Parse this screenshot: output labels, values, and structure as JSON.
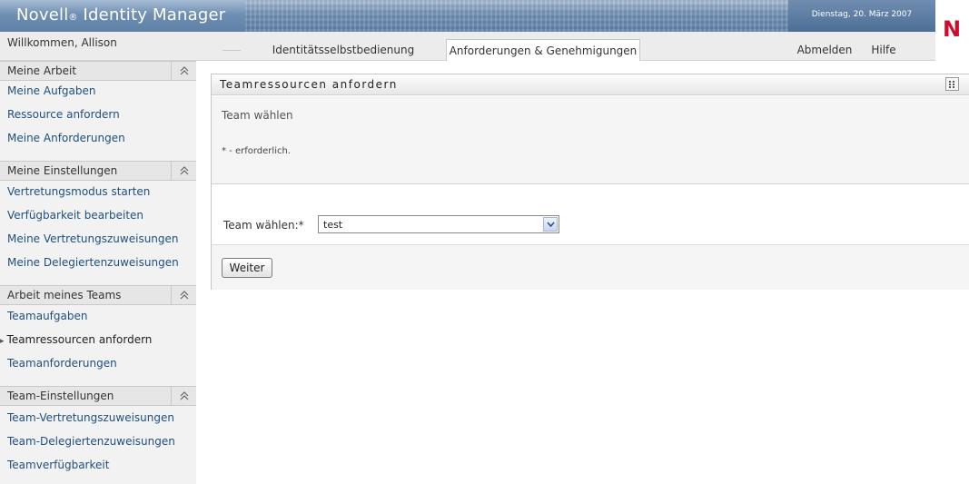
{
  "header": {
    "app_name": "Novell",
    "registered_mark": "®",
    "app_product": "Identity Manager",
    "date": "Dienstag, 20. März 2007",
    "brand_letter": "N"
  },
  "subbar": {
    "welcome": "Willkommen, Allison",
    "tabs": [
      {
        "label": "Identitätsselbstbedienung",
        "active": false
      },
      {
        "label": "Anforderungen & Genehmigungen",
        "active": true
      }
    ],
    "logout": "Abmelden",
    "help": "Hilfe"
  },
  "sidebar": {
    "sections": [
      {
        "title": "Meine Arbeit",
        "items": [
          "Meine Aufgaben",
          "Ressource anfordern",
          "Meine Anforderungen"
        ]
      },
      {
        "title": "Meine Einstellungen",
        "items": [
          "Vertretungsmodus starten",
          "Verfügbarkeit bearbeiten",
          "Meine Vertretungszuweisungen",
          "Meine Delegiertenzuweisungen"
        ]
      },
      {
        "title": "Arbeit meines Teams",
        "items": [
          "Teamaufgaben",
          "Teamressourcen anfordern",
          "Teamanforderungen"
        ],
        "current_index": 1
      },
      {
        "title": "Team-Einstellungen",
        "items": [
          "Team-Vertretungszuweisungen",
          "Team-Delegiertenzuweisungen",
          "Teamverfügbarkeit"
        ]
      }
    ]
  },
  "panel": {
    "title": "Teamressourcen anfordern",
    "heading": "Team wählen",
    "required_note": "* - erforderlich.",
    "field_label": "Team wählen:*",
    "select_value": "test",
    "submit_label": "Weiter"
  },
  "colors": {
    "link": "#1f4f7f",
    "brand_red": "#c8102e",
    "header_blue": "#6f8fb2"
  },
  "icons": {
    "collapse": "double-chevron-up-icon",
    "panel_menu": "grid-icon",
    "dropdown": "chevron-down-icon",
    "current_item": "triangle-bullet-icon"
  }
}
